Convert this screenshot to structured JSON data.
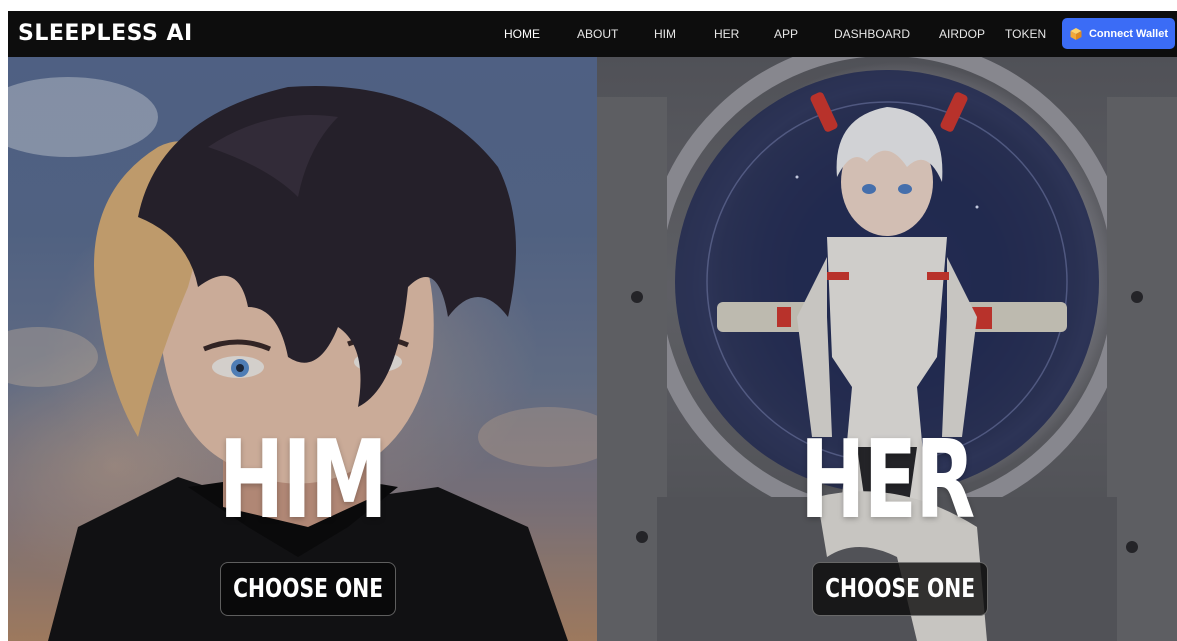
{
  "brand": {
    "logo_text": "SLEEPLESS AI"
  },
  "nav": {
    "items": [
      {
        "label": "HOME",
        "active": true
      },
      {
        "label": "ABOUT",
        "active": false
      },
      {
        "label": "HIM",
        "active": false
      },
      {
        "label": "HER",
        "active": false
      },
      {
        "label": "APP",
        "active": false
      },
      {
        "label": "DASHBOARD",
        "active": false
      },
      {
        "label": "AIRDOP",
        "active": false
      },
      {
        "label": "TOKEN",
        "active": false
      }
    ],
    "connect_wallet_label": "Connect Wallet",
    "connect_wallet_icon": "wallet-cube-icon"
  },
  "hero": {
    "him": {
      "title": "HIM",
      "button_label": "CHOOSE ONE",
      "image_subject": "anime-male-portrait"
    },
    "her": {
      "title": "HER",
      "button_label": "CHOOSE ONE",
      "image_subject": "anime-female-mecha-portrait"
    }
  },
  "colors": {
    "navbar_bg": "#0d0d0d",
    "accent_blue": "#3b6cf6",
    "text_white": "#ffffff",
    "button_bg": "#080808"
  }
}
